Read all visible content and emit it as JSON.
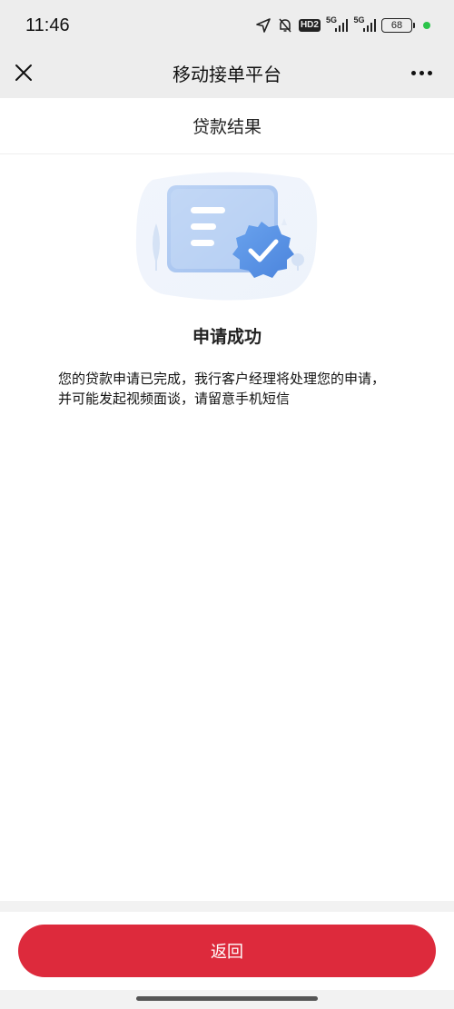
{
  "status_bar": {
    "time": "11:46",
    "hd_label": "HD2",
    "network_1": "5G",
    "network_2": "5G",
    "battery_level": "68",
    "icons": [
      "location-arrow-icon",
      "bell-muted-icon",
      "signal-icon",
      "battery-icon"
    ]
  },
  "nav": {
    "title": "移动接单平台",
    "close_icon": "close-icon",
    "more_icon": "more-dots-icon"
  },
  "page": {
    "header": "贷款结果",
    "result_title": "申请成功",
    "result_description": "您的贷款申请已完成，我行客户经理将处理您的申请，并可能发起视频面谈，请留意手机短信",
    "illustration": "document-checkmark-illustration"
  },
  "footer": {
    "return_label": "返回"
  },
  "colors": {
    "accent": "#dd2a3c",
    "illustration_blue": "#5b94e6"
  }
}
